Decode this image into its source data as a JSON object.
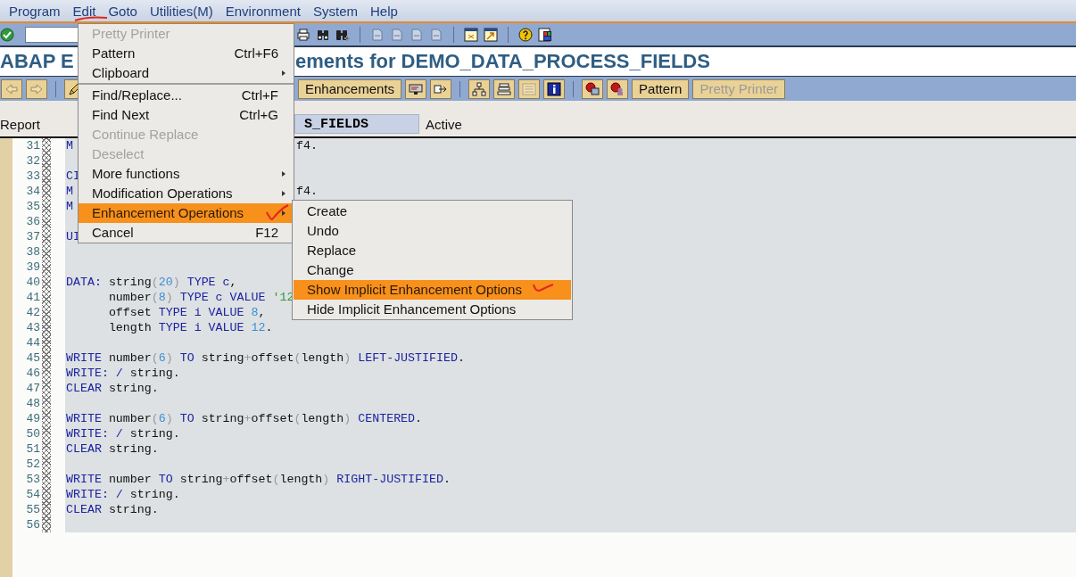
{
  "menu_bar": [
    {
      "label": "Program"
    },
    {
      "label": "Edit"
    },
    {
      "label": "Goto"
    },
    {
      "label": "Utilities(M)"
    },
    {
      "label": "Environment"
    },
    {
      "label": "System"
    },
    {
      "label": "Help"
    }
  ],
  "title_visible_parts": [
    "ABAP E",
    "ements for DEMO_DATA_PROCESS_FIELDS"
  ],
  "app_toolbar": {
    "buttons": [
      {
        "label": "Enhancements",
        "disabled": false
      },
      {
        "label": "Pattern",
        "disabled": false
      },
      {
        "label": "Pretty Printer",
        "disabled": true
      }
    ]
  },
  "program_row": {
    "label": "Report",
    "field_value": "S_FIELDS",
    "status": "Active"
  },
  "editor": {
    "lines": [
      {
        "num": "31",
        "left": [
          {
            "kind": "kw",
            "t": "M"
          }
        ],
        "right": [
          {
            "kind": "txt",
            "t": "f4."
          }
        ]
      },
      {
        "num": "32"
      },
      {
        "num": "33",
        "left": [
          {
            "kind": "kw",
            "t": "CI"
          }
        ]
      },
      {
        "num": "34",
        "left": [
          {
            "kind": "kw",
            "t": "M"
          }
        ],
        "right": [
          {
            "kind": "txt",
            "t": "f4."
          }
        ]
      },
      {
        "num": "35",
        "left": [
          {
            "kind": "kw",
            "t": "M"
          }
        ]
      },
      {
        "num": "36"
      },
      {
        "num": "37",
        "left": [
          {
            "kind": "kw",
            "t": "UI"
          }
        ]
      },
      {
        "num": "38"
      },
      {
        "num": "39"
      },
      {
        "num": "40",
        "left": [
          {
            "kind": "kw",
            "t": "DATA:"
          },
          {
            "kind": "txt",
            "t": " string"
          },
          {
            "kind": "pn",
            "t": "("
          },
          {
            "kind": "num",
            "t": "20"
          },
          {
            "kind": "pn",
            "t": ")"
          },
          {
            "kind": "kw",
            "t": " TYPE c"
          },
          {
            "kind": "txt",
            "t": ","
          }
        ]
      },
      {
        "num": "41",
        "left": [
          {
            "kind": "txt",
            "t": "      number"
          },
          {
            "kind": "pn",
            "t": "("
          },
          {
            "kind": "num",
            "t": "8"
          },
          {
            "kind": "pn",
            "t": ")"
          },
          {
            "kind": "kw",
            "t": " TYPE c VALUE"
          },
          {
            "kind": "lit",
            "t": " '12"
          }
        ]
      },
      {
        "num": "42",
        "left": [
          {
            "kind": "txt",
            "t": "      offset "
          },
          {
            "kind": "kw",
            "t": "TYPE i VALUE"
          },
          {
            "kind": "num",
            "t": " 8"
          },
          {
            "kind": "txt",
            "t": ","
          }
        ]
      },
      {
        "num": "43",
        "left": [
          {
            "kind": "txt",
            "t": "      length "
          },
          {
            "kind": "kw",
            "t": "TYPE i VALUE"
          },
          {
            "kind": "num",
            "t": " 12"
          },
          {
            "kind": "txt",
            "t": "."
          }
        ]
      },
      {
        "num": "44"
      },
      {
        "num": "45",
        "left": [
          {
            "kind": "kw",
            "t": "WRITE"
          },
          {
            "kind": "txt",
            "t": " number"
          },
          {
            "kind": "pn",
            "t": "("
          },
          {
            "kind": "num",
            "t": "6"
          },
          {
            "kind": "pn",
            "t": ")"
          },
          {
            "kind": "kw",
            "t": " TO"
          },
          {
            "kind": "txt",
            "t": " string"
          },
          {
            "kind": "pn",
            "t": "+"
          },
          {
            "kind": "txt",
            "t": "offset"
          },
          {
            "kind": "pn",
            "t": "("
          },
          {
            "kind": "txt",
            "t": "length"
          },
          {
            "kind": "pn",
            "t": ")"
          },
          {
            "kind": "kw",
            "t": " LEFT-JUSTIFIED"
          },
          {
            "kind": "txt",
            "t": "."
          }
        ]
      },
      {
        "num": "46",
        "left": [
          {
            "kind": "kw",
            "t": "WRITE: /"
          },
          {
            "kind": "txt",
            "t": " string."
          }
        ]
      },
      {
        "num": "47",
        "left": [
          {
            "kind": "kw",
            "t": "CLEAR"
          },
          {
            "kind": "txt",
            "t": " string."
          }
        ]
      },
      {
        "num": "48"
      },
      {
        "num": "49",
        "left": [
          {
            "kind": "kw",
            "t": "WRITE"
          },
          {
            "kind": "txt",
            "t": " number"
          },
          {
            "kind": "pn",
            "t": "("
          },
          {
            "kind": "num",
            "t": "6"
          },
          {
            "kind": "pn",
            "t": ")"
          },
          {
            "kind": "kw",
            "t": " TO"
          },
          {
            "kind": "txt",
            "t": " string"
          },
          {
            "kind": "pn",
            "t": "+"
          },
          {
            "kind": "txt",
            "t": "offset"
          },
          {
            "kind": "pn",
            "t": "("
          },
          {
            "kind": "txt",
            "t": "length"
          },
          {
            "kind": "pn",
            "t": ")"
          },
          {
            "kind": "kw",
            "t": " CENTERED"
          },
          {
            "kind": "txt",
            "t": "."
          }
        ]
      },
      {
        "num": "50",
        "left": [
          {
            "kind": "kw",
            "t": "WRITE: /"
          },
          {
            "kind": "txt",
            "t": " string."
          }
        ]
      },
      {
        "num": "51",
        "left": [
          {
            "kind": "kw",
            "t": "CLEAR"
          },
          {
            "kind": "txt",
            "t": " string."
          }
        ]
      },
      {
        "num": "52"
      },
      {
        "num": "53",
        "left": [
          {
            "kind": "kw",
            "t": "WRITE"
          },
          {
            "kind": "txt",
            "t": " number"
          },
          {
            "kind": "kw",
            "t": " TO"
          },
          {
            "kind": "txt",
            "t": " string"
          },
          {
            "kind": "pn",
            "t": "+"
          },
          {
            "kind": "txt",
            "t": "offset"
          },
          {
            "kind": "pn",
            "t": "("
          },
          {
            "kind": "txt",
            "t": "length"
          },
          {
            "kind": "pn",
            "t": ")"
          },
          {
            "kind": "kw",
            "t": " RIGHT-JUSTIFIED"
          },
          {
            "kind": "txt",
            "t": "."
          }
        ]
      },
      {
        "num": "54",
        "left": [
          {
            "kind": "kw",
            "t": "WRITE: /"
          },
          {
            "kind": "txt",
            "t": " string."
          }
        ]
      },
      {
        "num": "55",
        "left": [
          {
            "kind": "kw",
            "t": "CLEAR"
          },
          {
            "kind": "txt",
            "t": " string."
          }
        ]
      },
      {
        "num": "56"
      }
    ]
  },
  "edit_menu": {
    "items": [
      {
        "label": "Pretty Printer",
        "disabled": true,
        "selected": false,
        "submenu": false,
        "separator_after": false
      },
      {
        "label": "Pattern",
        "shortcut": "Ctrl+F6",
        "disabled": false,
        "selected": false,
        "submenu": false,
        "separator_after": false
      },
      {
        "label": "Clipboard",
        "disabled": false,
        "selected": false,
        "submenu": true,
        "separator_after": true
      },
      {
        "label": "Find/Replace...",
        "shortcut": "Ctrl+F",
        "disabled": false,
        "selected": false,
        "submenu": false,
        "separator_after": false
      },
      {
        "label": "Find Next",
        "shortcut": "Ctrl+G",
        "disabled": false,
        "selected": false,
        "submenu": false,
        "separator_after": false
      },
      {
        "label": "Continue Replace",
        "disabled": true,
        "selected": false,
        "submenu": false,
        "separator_after": false
      },
      {
        "label": "Deselect",
        "disabled": true,
        "selected": false,
        "submenu": false,
        "separator_after": false
      },
      {
        "label": "More functions",
        "disabled": false,
        "selected": false,
        "submenu": true,
        "separator_after": false
      },
      {
        "label": "Modification Operations",
        "disabled": false,
        "selected": false,
        "submenu": true,
        "separator_after": false
      },
      {
        "label": "Enhancement Operations",
        "disabled": false,
        "selected": true,
        "submenu": true,
        "separator_after": false
      },
      {
        "label": "Cancel",
        "shortcut": "F12",
        "disabled": false,
        "selected": false,
        "submenu": false,
        "separator_after": false
      }
    ]
  },
  "submenu": {
    "items": [
      {
        "label": "Create",
        "selected": false
      },
      {
        "label": "Undo",
        "selected": false
      },
      {
        "label": "Replace",
        "selected": false
      },
      {
        "label": "Change",
        "selected": false
      },
      {
        "label": "Show Implicit Enhancement Options",
        "selected": true
      },
      {
        "label": "Hide Implicit Enhancement Options",
        "selected": false
      }
    ]
  }
}
